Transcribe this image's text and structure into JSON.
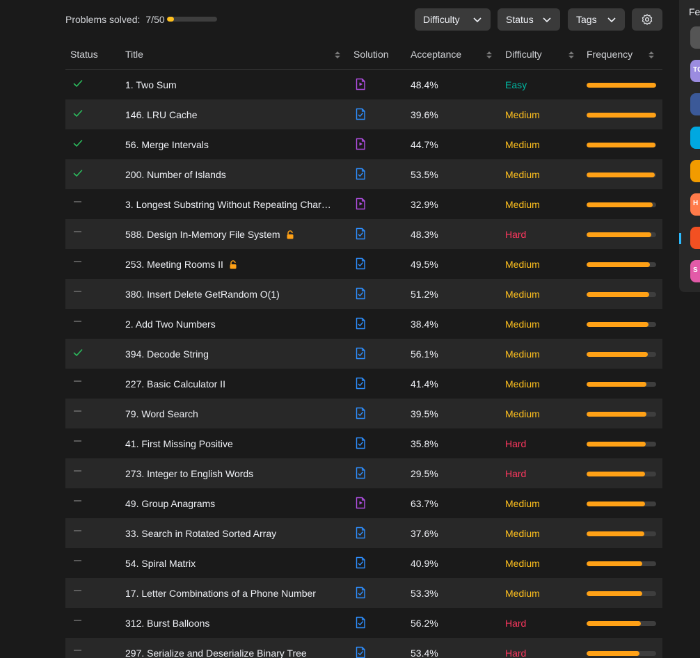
{
  "header": {
    "solved_label": "Problems solved:",
    "solved_count": "7/50",
    "solved_progress": 0.14,
    "filters": {
      "difficulty": "Difficulty",
      "status": "Status",
      "tags": "Tags"
    }
  },
  "table": {
    "columns": [
      "Status",
      "Title",
      "Solution",
      "Acceptance",
      "Difficulty",
      "Frequency"
    ],
    "rows": [
      {
        "status": "solved",
        "title": "1. Two Sum",
        "locked": false,
        "solution": "video",
        "acceptance": "48.4%",
        "difficulty": "Easy",
        "frequency": 1.0
      },
      {
        "status": "solved",
        "title": "146. LRU Cache",
        "locked": false,
        "solution": "article",
        "acceptance": "39.6%",
        "difficulty": "Medium",
        "frequency": 1.0
      },
      {
        "status": "solved",
        "title": "56. Merge Intervals",
        "locked": false,
        "solution": "video",
        "acceptance": "44.7%",
        "difficulty": "Medium",
        "frequency": 0.99
      },
      {
        "status": "solved",
        "title": "200. Number of Islands",
        "locked": false,
        "solution": "article",
        "acceptance": "53.5%",
        "difficulty": "Medium",
        "frequency": 0.98
      },
      {
        "status": "todo",
        "title": "3. Longest Substring Without Repeating Chara...",
        "locked": false,
        "solution": "video",
        "acceptance": "32.9%",
        "difficulty": "Medium",
        "frequency": 0.95
      },
      {
        "status": "todo",
        "title": "588. Design In-Memory File System",
        "locked": true,
        "solution": "article",
        "acceptance": "48.3%",
        "difficulty": "Hard",
        "frequency": 0.93
      },
      {
        "status": "todo",
        "title": "253. Meeting Rooms II",
        "locked": true,
        "solution": "article",
        "acceptance": "49.5%",
        "difficulty": "Medium",
        "frequency": 0.91
      },
      {
        "status": "todo",
        "title": "380. Insert Delete GetRandom O(1)",
        "locked": false,
        "solution": "article",
        "acceptance": "51.2%",
        "difficulty": "Medium",
        "frequency": 0.9
      },
      {
        "status": "todo",
        "title": "2. Add Two Numbers",
        "locked": false,
        "solution": "article",
        "acceptance": "38.4%",
        "difficulty": "Medium",
        "frequency": 0.89
      },
      {
        "status": "solved",
        "title": "394. Decode String",
        "locked": false,
        "solution": "article",
        "acceptance": "56.1%",
        "difficulty": "Medium",
        "frequency": 0.88
      },
      {
        "status": "todo",
        "title": "227. Basic Calculator II",
        "locked": false,
        "solution": "article",
        "acceptance": "41.4%",
        "difficulty": "Medium",
        "frequency": 0.86
      },
      {
        "status": "todo",
        "title": "79. Word Search",
        "locked": false,
        "solution": "article",
        "acceptance": "39.5%",
        "difficulty": "Medium",
        "frequency": 0.86
      },
      {
        "status": "todo",
        "title": "41. First Missing Positive",
        "locked": false,
        "solution": "article",
        "acceptance": "35.8%",
        "difficulty": "Hard",
        "frequency": 0.85
      },
      {
        "status": "todo",
        "title": "273. Integer to English Words",
        "locked": false,
        "solution": "article",
        "acceptance": "29.5%",
        "difficulty": "Hard",
        "frequency": 0.84
      },
      {
        "status": "todo",
        "title": "49. Group Anagrams",
        "locked": false,
        "solution": "video",
        "acceptance": "63.7%",
        "difficulty": "Medium",
        "frequency": 0.84
      },
      {
        "status": "todo",
        "title": "33. Search in Rotated Sorted Array",
        "locked": false,
        "solution": "article",
        "acceptance": "37.6%",
        "difficulty": "Medium",
        "frequency": 0.83
      },
      {
        "status": "todo",
        "title": "54. Spiral Matrix",
        "locked": false,
        "solution": "article",
        "acceptance": "40.9%",
        "difficulty": "Medium",
        "frequency": 0.8
      },
      {
        "status": "todo",
        "title": "17. Letter Combinations of a Phone Number",
        "locked": false,
        "solution": "article",
        "acceptance": "53.3%",
        "difficulty": "Medium",
        "frequency": 0.8
      },
      {
        "status": "todo",
        "title": "312. Burst Balloons",
        "locked": false,
        "solution": "article",
        "acceptance": "56.2%",
        "difficulty": "Hard",
        "frequency": 0.78
      },
      {
        "status": "todo",
        "title": "297. Serialize and Deserialize Binary Tree",
        "locked": false,
        "solution": "article",
        "acceptance": "53.4%",
        "difficulty": "Hard",
        "frequency": 0.76
      }
    ]
  },
  "right_panel": {
    "label": "Fe",
    "items": [
      {
        "name": "laptop-company-logo",
        "text": "",
        "color": "#555555"
      },
      {
        "name": "purple-company-logo",
        "text": "TC",
        "color": "#9b8ce0"
      },
      {
        "name": "blue-company-logo",
        "text": "",
        "color": "#3b5998"
      },
      {
        "name": "ring-company-logo",
        "text": "",
        "color": "#00a8e0"
      },
      {
        "name": "amazon-logo",
        "text": "",
        "color": "#f29b00"
      },
      {
        "name": "orange-company-logo",
        "text": "H",
        "color": "#ff7b4a"
      },
      {
        "name": "windows-logo",
        "text": "",
        "color": "#f25022"
      },
      {
        "name": "pink-company-logo",
        "text": "S",
        "color": "#e35aa8"
      }
    ]
  },
  "colors": {
    "easy": "#00b8a3",
    "medium": "#ffc01e",
    "hard": "#ff375f",
    "frequency": "#ffa116",
    "solved_check": "#2cbb5d",
    "video_solution": "#b24fe4",
    "article_solution": "#2e8fff"
  }
}
